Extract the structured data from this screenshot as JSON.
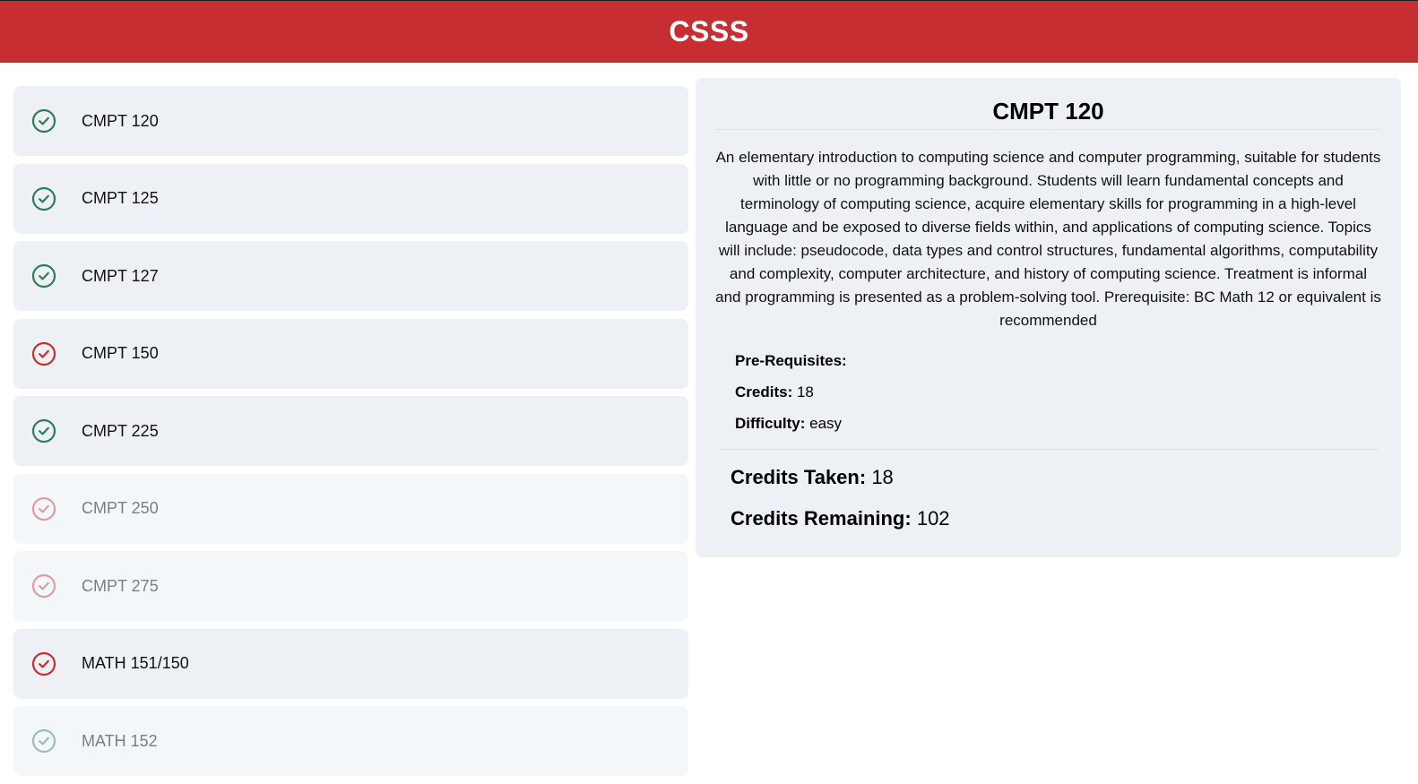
{
  "header": {
    "title": "CSSS"
  },
  "courses": [
    {
      "code": "CMPT 120",
      "status": "complete",
      "disabled": false,
      "icon": "check-circle-icon"
    },
    {
      "code": "CMPT 125",
      "status": "complete",
      "disabled": false,
      "icon": "check-circle-icon"
    },
    {
      "code": "CMPT 127",
      "status": "complete",
      "disabled": false,
      "icon": "check-circle-icon"
    },
    {
      "code": "CMPT 150",
      "status": "incomplete",
      "disabled": false,
      "icon": "check-circle-icon"
    },
    {
      "code": "CMPT 225",
      "status": "complete",
      "disabled": false,
      "icon": "check-circle-icon"
    },
    {
      "code": "CMPT 250",
      "status": "incomplete",
      "disabled": true,
      "icon": "check-circle-icon"
    },
    {
      "code": "CMPT 275",
      "status": "incomplete",
      "disabled": true,
      "icon": "check-circle-icon"
    },
    {
      "code": "MATH 151/150",
      "status": "incomplete",
      "disabled": false,
      "icon": "check-circle-icon"
    },
    {
      "code": "MATH 152",
      "status": "complete",
      "disabled": true,
      "icon": "check-circle-icon"
    }
  ],
  "colors": {
    "header_bg": "#c62e31",
    "complete": "#2e7d57",
    "incomplete": "#c62e31",
    "card_bg": "#edf1f5"
  },
  "detail": {
    "title": "CMPT 120",
    "description": "An elementary introduction to computing science and computer programming, suitable for students with little or no programming background. Students will learn fundamental concepts and terminology of computing science, acquire elementary skills for programming in a high-level language and be exposed to diverse fields within, and applications of computing science. Topics will include: pseudocode, data types and control structures, fundamental algorithms, computability and complexity, computer architecture, and history of computing science. Treatment is informal and programming is presented as a problem-solving tool. Prerequisite: BC Math 12 or equivalent is recommended",
    "prereq_label": "Pre-Requisites:",
    "prereq_value": "",
    "credits_label": "Credits:",
    "credits_value": "18",
    "difficulty_label": "Difficulty:",
    "difficulty_value": "easy"
  },
  "totals": {
    "taken_label": "Credits Taken:",
    "taken_value": "18",
    "remaining_label": "Credits Remaining:",
    "remaining_value": "102"
  }
}
